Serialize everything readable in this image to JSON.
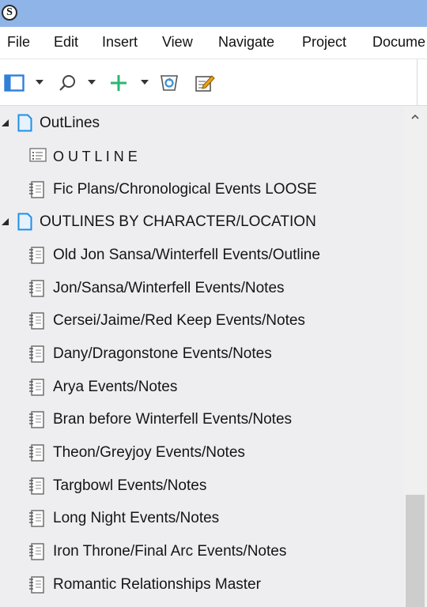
{
  "titlebar": {
    "app_icon_letter": "S"
  },
  "menu": [
    "File",
    "Edit",
    "Insert",
    "View",
    "Navigate",
    "Project",
    "Docume"
  ],
  "toolbar": {
    "icons": [
      "binder-toggle-icon",
      "search-icon",
      "add-icon",
      "trash-icon",
      "compose-icon"
    ],
    "colors": {
      "add": "#2bb673",
      "binder": "#2f7fd8",
      "trash": "#3a8fd6",
      "compose": "#e8a317"
    }
  },
  "binder": {
    "items": [
      {
        "label": "OutLines",
        "type": "folder",
        "level": 0,
        "expanded": true
      },
      {
        "label": "O U T L I N E",
        "type": "outline",
        "level": 1
      },
      {
        "label": "Fic Plans/Chronological Events LOOSE",
        "type": "document",
        "level": 1
      },
      {
        "label": "OUTLINES BY CHARACTER/LOCATION",
        "type": "folder",
        "level": 0,
        "expanded": true
      },
      {
        "label": "Old Jon Sansa/Winterfell Events/Outline",
        "type": "document",
        "level": 1
      },
      {
        "label": "Jon/Sansa/Winterfell Events/Notes",
        "type": "document",
        "level": 1
      },
      {
        "label": "Cersei/Jaime/Red Keep Events/Notes",
        "type": "document",
        "level": 1
      },
      {
        "label": "Dany/Dragonstone Events/Notes",
        "type": "document",
        "level": 1
      },
      {
        "label": "Arya Events/Notes",
        "type": "document",
        "level": 1
      },
      {
        "label": "Bran before Winterfell Events/Notes",
        "type": "document",
        "level": 1
      },
      {
        "label": "Theon/Greyjoy Events/Notes",
        "type": "document",
        "level": 1
      },
      {
        "label": "Targbowl Events/Notes",
        "type": "document",
        "level": 1
      },
      {
        "label": "Long Night Events/Notes",
        "type": "document",
        "level": 1
      },
      {
        "label": "Iron Throne/Final Arc Events/Notes",
        "type": "document",
        "level": 1
      },
      {
        "label": "Romantic Relationships Master",
        "type": "document",
        "level": 1
      }
    ]
  }
}
